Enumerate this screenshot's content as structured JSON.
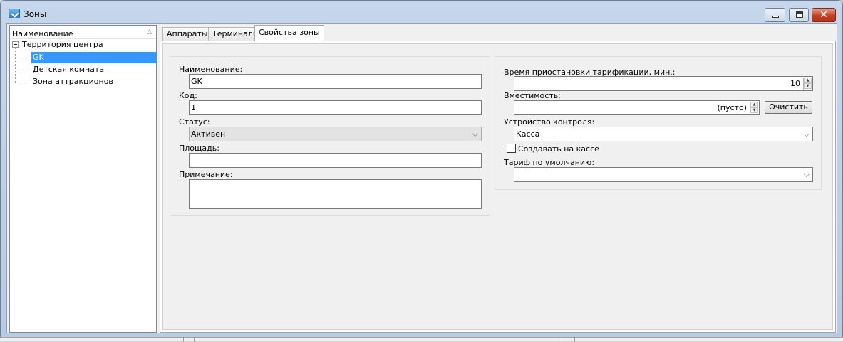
{
  "window": {
    "title": "Зоны",
    "controls": {
      "minimize": "minimize",
      "maximize": "maximize",
      "close": "✕"
    }
  },
  "tree": {
    "header": "Наименование",
    "root": "Территория центра",
    "items": [
      "GK",
      "Детская комната",
      "Зона аттракционов"
    ],
    "selected": "GK"
  },
  "tabs": [
    {
      "label": "Аппараты"
    },
    {
      "label": "Терминалы"
    },
    {
      "label": "Свойства зоны",
      "active": true
    }
  ],
  "left_group": {
    "name_label": "Наименование:",
    "name_value": "GK",
    "code_label": "Код:",
    "code_value": "1",
    "status_label": "Статус:",
    "status_value": "Активен",
    "area_label": "Площадь:",
    "area_value": "",
    "note_label": "Примечание:",
    "note_value": ""
  },
  "right_group": {
    "pause_label": "Время приостановки тарификации, мин.:",
    "pause_value": "10",
    "capacity_label": "Вместимость:",
    "capacity_value": "(пусто)",
    "clear_button": "Очистить",
    "device_label": "Устройство контроля:",
    "device_value": "Касса",
    "create_at_cashier_label": "Создавать на кассе",
    "create_at_cashier_checked": false,
    "tariff_label": "Тариф по умолчанию:",
    "tariff_value": ""
  }
}
